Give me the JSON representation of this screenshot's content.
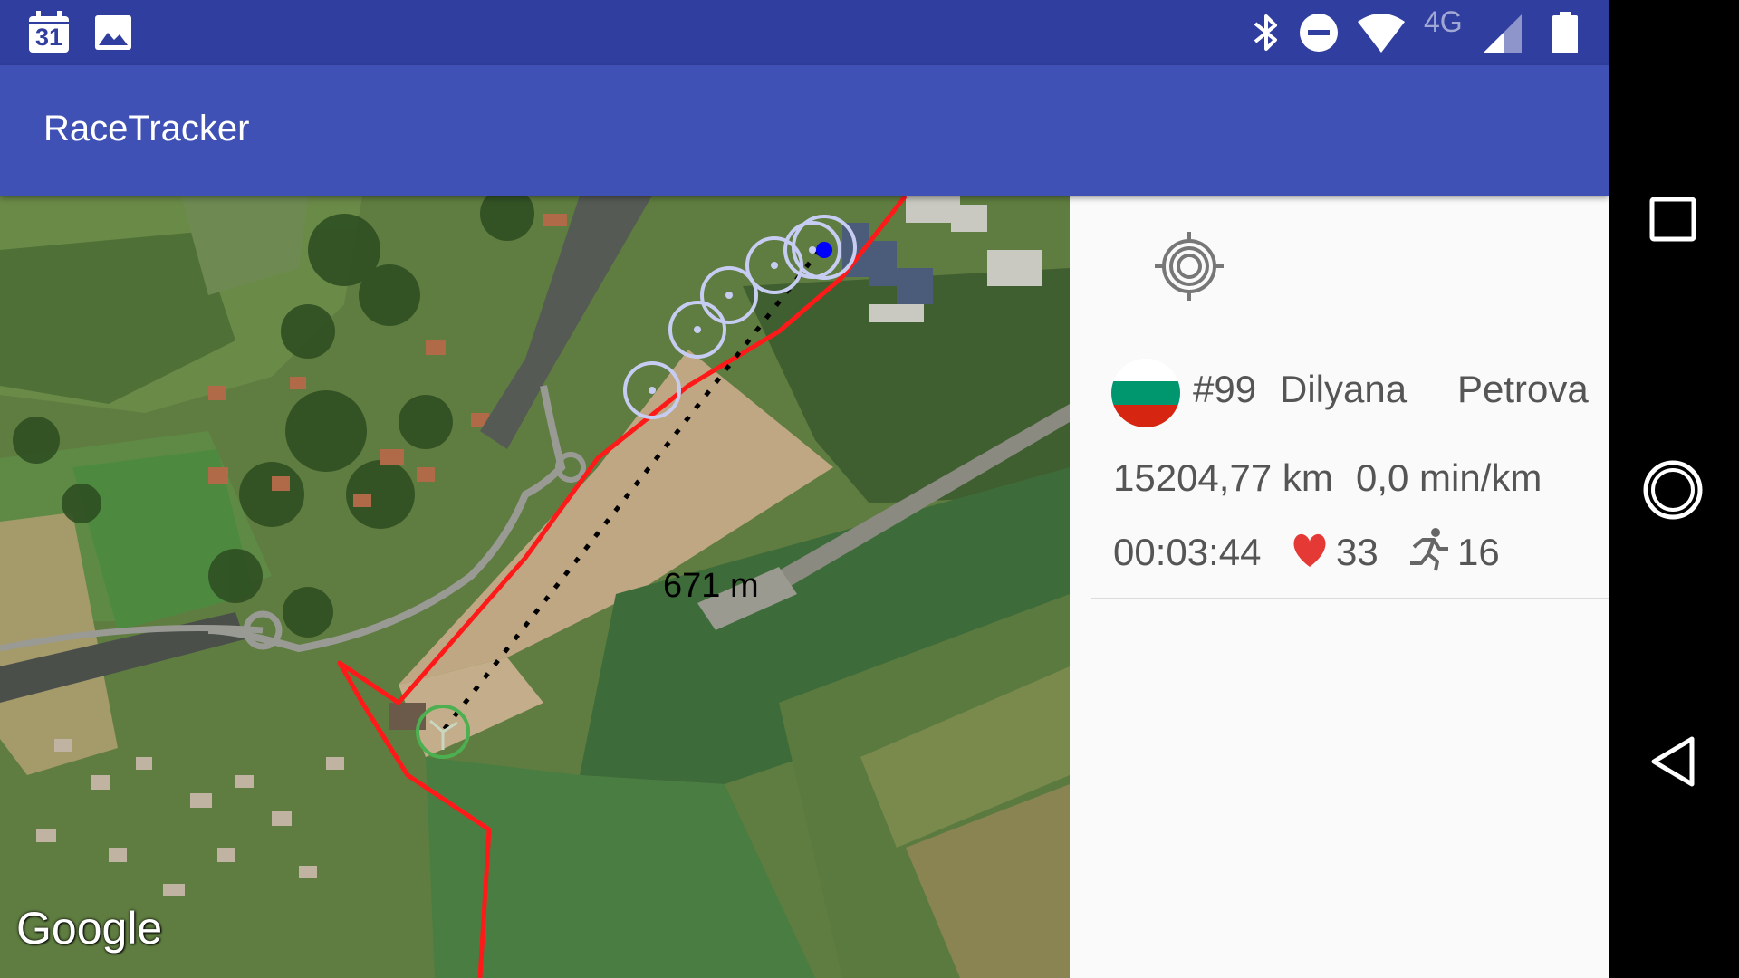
{
  "status_bar": {
    "calendar_day": "31",
    "network_type": "4G",
    "icons": [
      "calendar-icon",
      "image-icon",
      "bluetooth-icon",
      "do-not-disturb-icon",
      "wifi-icon",
      "signal-icon",
      "battery-icon"
    ]
  },
  "app": {
    "title": "RaceTracker"
  },
  "map": {
    "distance_label": "671 m",
    "provider": "Google",
    "route_color": "#FF0000",
    "position_color": "#0000FF",
    "start_color": "#4CAF50"
  },
  "runner": {
    "bib": "#99",
    "first_name": "Dilyana",
    "last_name": "Petrova",
    "distance": "15204,77 km",
    "pace": "0,0 min/km",
    "elapsed": "00:03:44",
    "heart_rate": "33",
    "cadence": "16",
    "flag_colors": [
      "#FFFFFF",
      "#00966E",
      "#D62612"
    ]
  },
  "colors": {
    "status_bar": "#303F9F",
    "app_bar": "#3F51B5",
    "heart": "#E53935"
  }
}
